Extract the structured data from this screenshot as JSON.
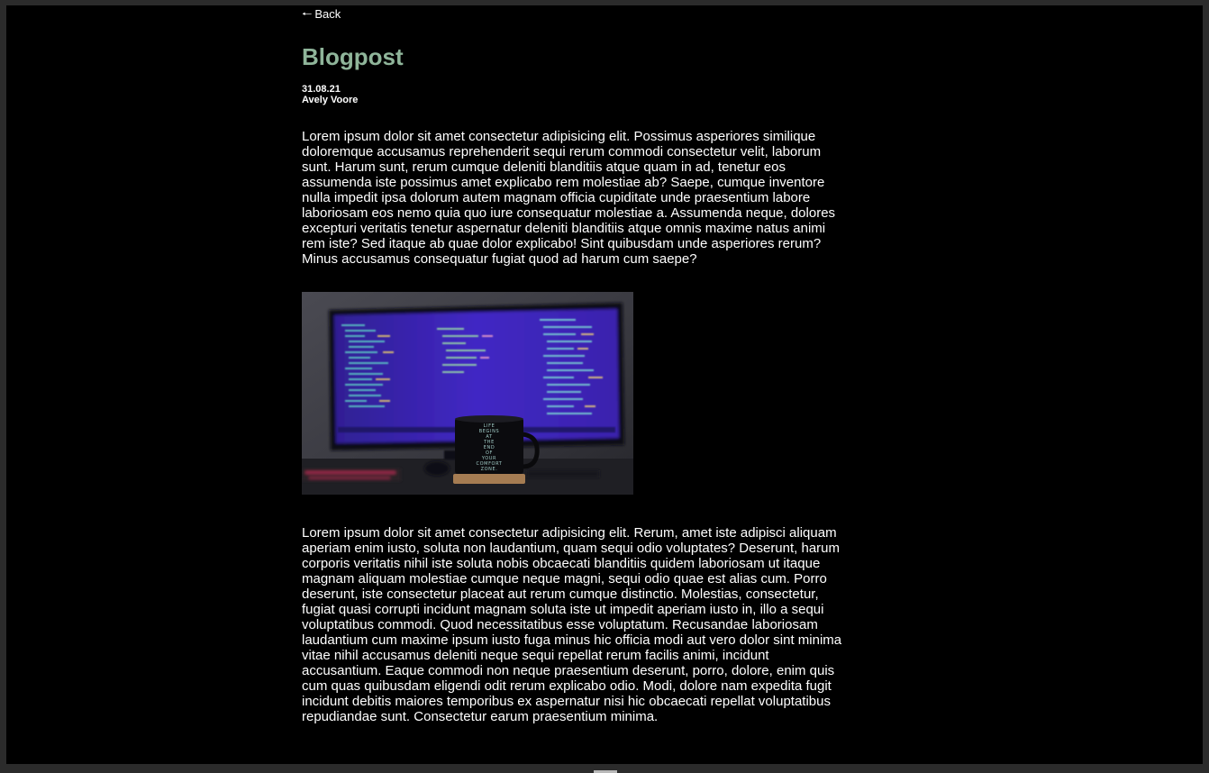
{
  "nav": {
    "back_arrow": "🠐",
    "back_label": "Back"
  },
  "post": {
    "title": "Blogpost",
    "date": "31.08.21",
    "author": "Avely Voore",
    "paragraph_1": "Lorem ipsum dolor sit amet consectetur adipisicing elit. Possimus asperiores similique doloremque accusamus reprehenderit sequi rerum commodi consectetur velit, laborum sunt. Harum sunt, rerum cumque deleniti blanditiis atque quam in ad, tenetur eos assumenda iste possimus amet explicabo rem molestiae ab? Saepe, cumque inventore nulla impedit ipsa dolorum autem magnam officia cupiditate unde praesentium labore laboriosam eos nemo quia quo iure consequatur molestiae a. Assumenda neque, dolores excepturi veritatis tenetur aspernatur deleniti blanditiis atque omnis maxime natus animi rem iste? Sed itaque ab quae dolor explicabo! Sint quibusdam unde asperiores rerum? Minus accusamus consequatur fugiat quod ad harum cum saepe?",
    "image": {
      "mug_text": [
        "LIFE",
        "BEGINS",
        "AT",
        "THE",
        "END",
        "OF",
        "YOUR",
        "COMFORT",
        "ZONE."
      ]
    },
    "paragraph_2": "Lorem ipsum dolor sit amet consectetur adipisicing elit. Rerum, amet iste adipisci aliquam aperiam enim iusto, soluta non laudantium, quam sequi odio voluptates? Deserunt, harum corporis veritatis nihil iste soluta nobis obcaecati blanditiis quidem laboriosam ut itaque magnam aliquam molestiae cumque neque magni, sequi odio quae est alias cum. Porro deserunt, iste consectetur placeat aut rerum cumque distinctio. Molestias, consectetur, fugiat quasi corrupti incidunt magnam soluta iste ut impedit aperiam iusto in, illo a sequi voluptatibus commodi. Quod necessitatibus esse voluptatum. Recusandae laboriosam laudantium cum maxime ipsum iusto fuga minus hic officia modi aut vero dolor sint minima vitae nihil accusamus deleniti neque sequi repellat rerum facilis animi, incidunt accusantium. Eaque commodi non neque praesentium deserunt, porro, dolore, enim quis cum quas quibusdam eligendi odit rerum explicabo odio. Modi, dolore nam expedita fugit incidunt debitis maiores temporibus ex aspernatur nisi hic obcaecati repellat voluptatibus repudiandae sunt. Consectetur earum praesentium minima."
  },
  "colors": {
    "page_background": "#000000",
    "window_frame": "#2b2b2b",
    "title": "#8fb59a",
    "text": "#ffffff"
  },
  "icons": {
    "back": "left-arrow-icon"
  }
}
